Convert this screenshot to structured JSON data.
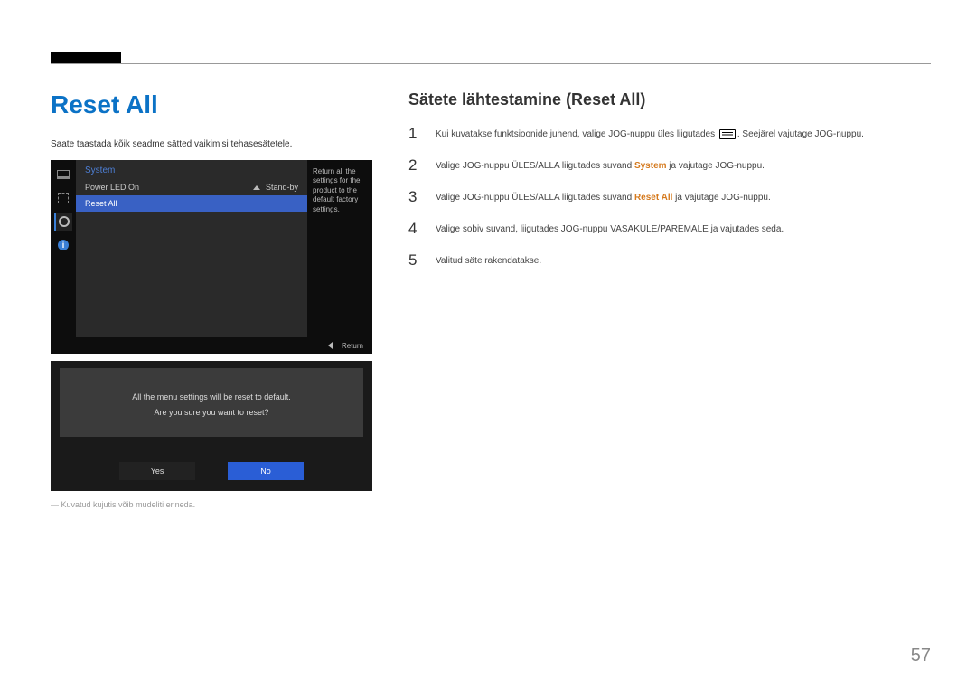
{
  "page_number": "57",
  "left": {
    "title": "Reset All",
    "desc": "Saate taastada kõik seadme sätted vaikimisi tehasesätetele.",
    "osd": {
      "title": "System",
      "rows": [
        {
          "label": "Power LED On",
          "value": "Stand-by",
          "selected": false
        },
        {
          "label": "Reset All",
          "value": "",
          "selected": true
        }
      ],
      "right_text": "Return all the settings for the product to the default factory settings.",
      "footer_return": "Return"
    },
    "confirm": {
      "line1": "All the menu settings will be reset to default.",
      "line2": "Are you sure you want to reset?",
      "yes": "Yes",
      "no": "No"
    },
    "caption": "Kuvatud kujutis võib mudeliti erineda."
  },
  "right": {
    "title": "Sätete lähtestamine (Reset All)",
    "steps": {
      "s1_a": "Kui kuvatakse funktsioonide juhend, valige JOG-nuppu üles liigutades ",
      "s1_b": ". Seejärel vajutage JOG-nuppu.",
      "s2_a": "Valige JOG-nuppu ÜLES/ALLA liigutades suvand ",
      "s2_system": "System",
      "s2_b": " ja vajutage JOG-nuppu.",
      "s3_a": "Valige JOG-nuppu ÜLES/ALLA liigutades suvand ",
      "s3_reset": "Reset All",
      "s3_b": " ja vajutage JOG-nuppu.",
      "s4": "Valige sobiv suvand, liigutades JOG-nuppu VASAKULE/PAREMALE ja vajutades seda.",
      "s5": "Valitud säte rakendatakse."
    }
  }
}
